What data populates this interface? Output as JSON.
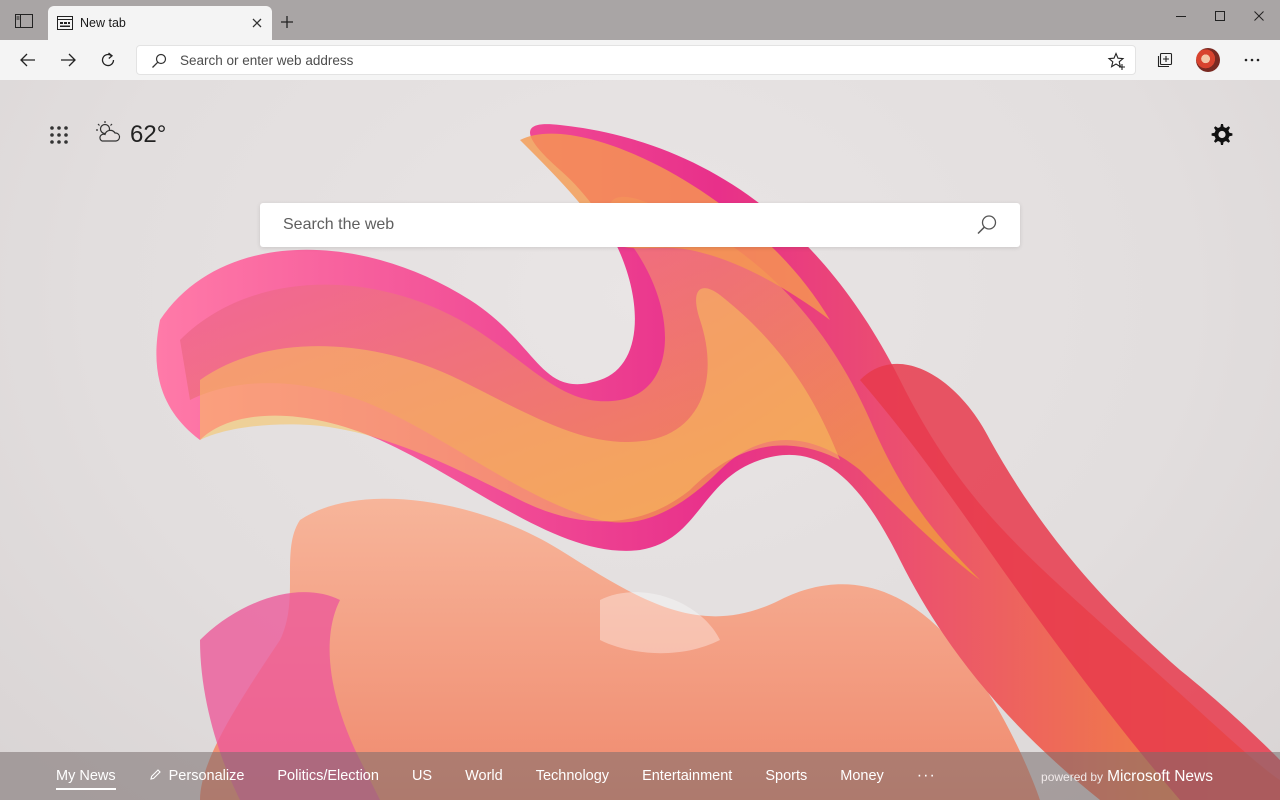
{
  "browser": {
    "tab_title": "New tab",
    "address_placeholder": "Search or enter web address"
  },
  "page": {
    "weather_temp": "62°",
    "search_placeholder": "Search the web"
  },
  "news_nav": {
    "items": [
      {
        "label": "My News",
        "active": true
      },
      {
        "label": "Personalize"
      },
      {
        "label": "Politics/Election"
      },
      {
        "label": "US"
      },
      {
        "label": "World"
      },
      {
        "label": "Technology"
      },
      {
        "label": "Entertainment"
      },
      {
        "label": "Sports"
      },
      {
        "label": "Money"
      }
    ],
    "more": "···",
    "powered_by": "powered by",
    "brand": "Microsoft News"
  },
  "icons": {
    "tab_actions": "tab-actions-icon",
    "favicon": "newtab-favicon-icon",
    "close": "close-icon",
    "add": "plus-icon",
    "minimize": "minimize-icon",
    "maximize": "maximize-icon",
    "window_close": "window-close-icon",
    "back": "back-arrow-icon",
    "forward": "forward-arrow-icon",
    "refresh": "refresh-icon",
    "search": "search-icon",
    "favorite": "star-add-icon",
    "collections": "collections-icon",
    "more": "ellipsis-icon",
    "apps": "app-launcher-icon",
    "weather": "partly-cloudy-icon",
    "settings": "gear-icon",
    "pencil": "pencil-icon"
  }
}
